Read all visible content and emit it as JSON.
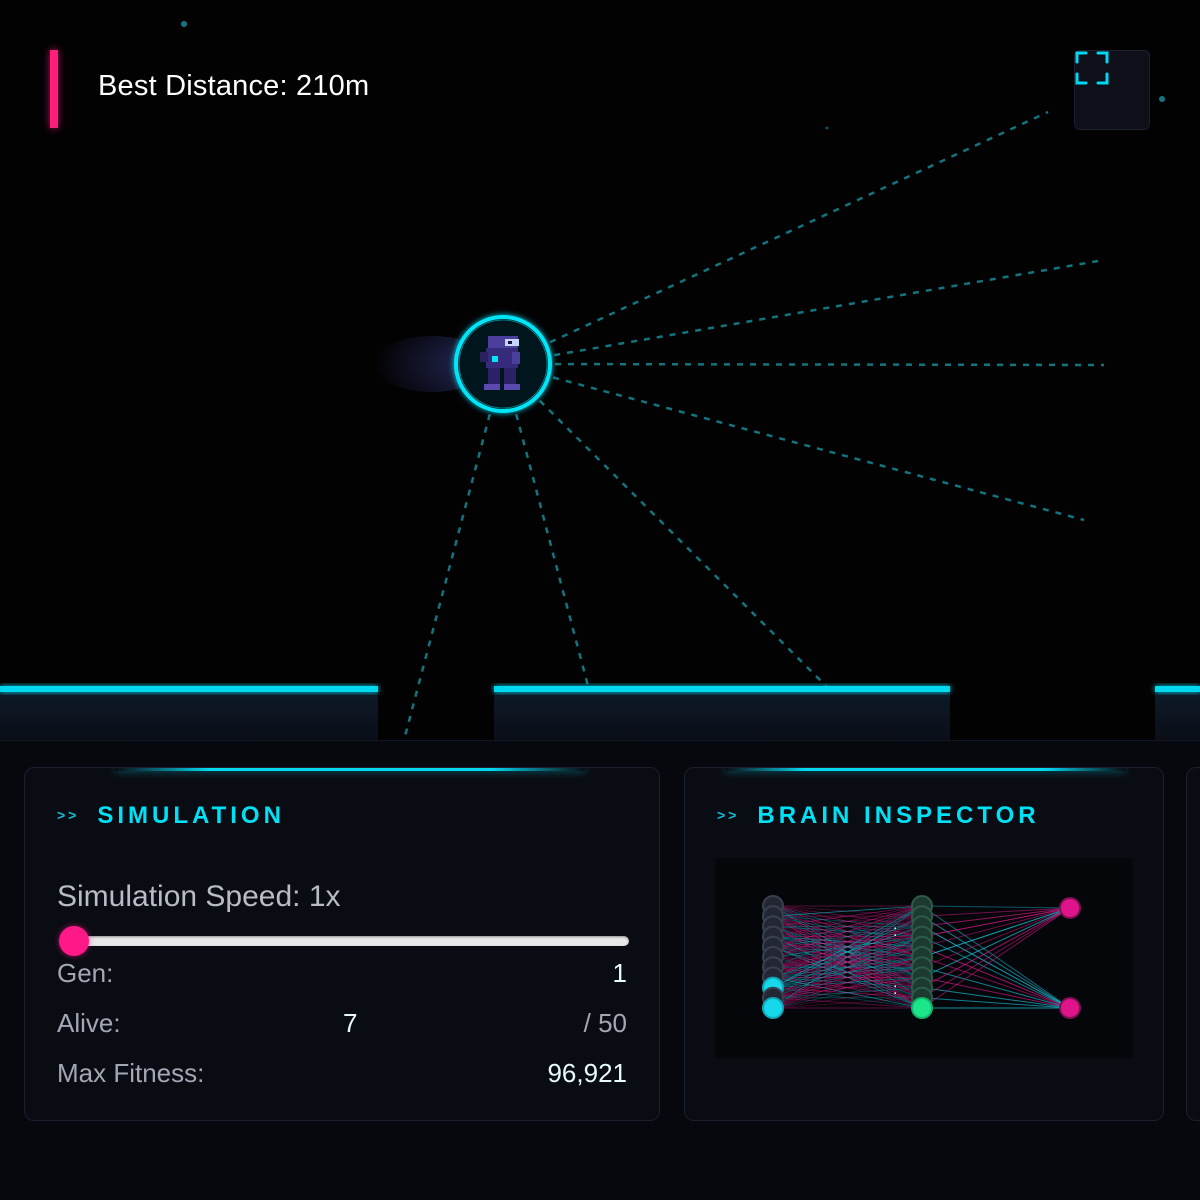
{
  "hud": {
    "best_distance": "Best Distance: 210m"
  },
  "fullscreen_icon": "fullscreen-icon",
  "colors": {
    "accent_cyan": "#00e1f5",
    "accent_pink": "#ff1f7a",
    "neuron_green": "#1de58a"
  },
  "simulation": {
    "prompt": ">>",
    "title": "SIMULATION",
    "speed_label": "Simulation Speed: 1x",
    "speed_value": 1,
    "gen_label": "Gen:",
    "gen_value": "1",
    "alive_label": "Alive:",
    "alive_value": "7",
    "alive_total": "/ 50",
    "fitness_label": "Max Fitness:",
    "fitness_value": "96,921"
  },
  "brain": {
    "prompt": ">>",
    "title": "BRAIN INSPECTOR",
    "ellipsis_top": ":",
    "ellipsis_bottom": ":"
  }
}
